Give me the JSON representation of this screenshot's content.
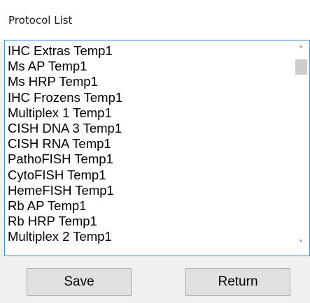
{
  "window": {
    "title": "Protocol List"
  },
  "protocols": [
    "IHC Extras Temp1",
    "Ms AP Temp1",
    "Ms HRP Temp1",
    "IHC Frozens Temp1",
    "Multiplex 1 Temp1",
    "CISH DNA 3 Temp1",
    "CISH RNA Temp1",
    "PathoFISH Temp1",
    "CytoFISH Temp1",
    "HemeFISH Temp1",
    "Rb AP Temp1",
    "Rb HRP Temp1",
    "Multiplex 2 Temp1"
  ],
  "scrollbar": {
    "up_icon": "chevron-up-icon",
    "down_icon": "chevron-down-icon"
  },
  "buttons": {
    "save_label": "Save",
    "return_label": "Return"
  },
  "colors": {
    "listbox_border": "#3c8fd6",
    "window_background": "#f0f0f0",
    "button_face": "#e1e1e1"
  }
}
